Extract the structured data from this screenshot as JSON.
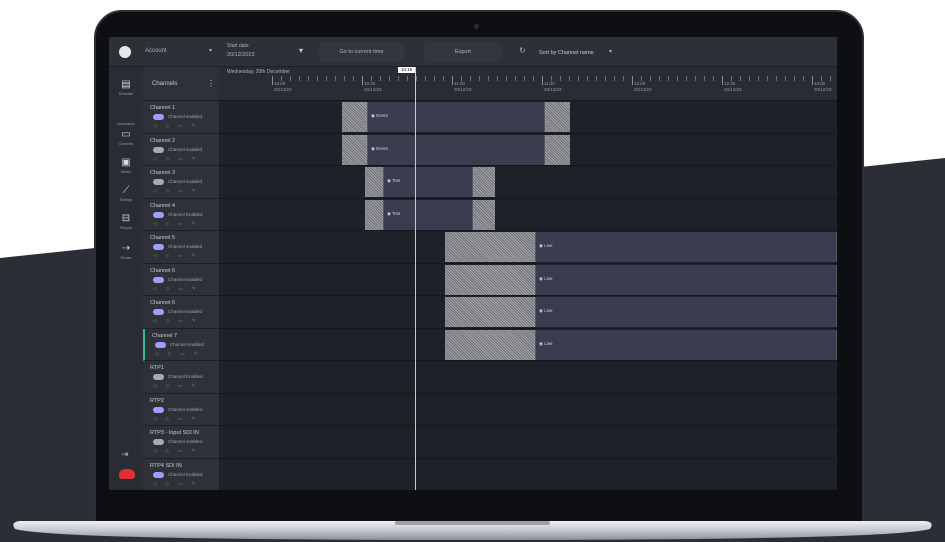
{
  "colors": {
    "accent": "#9aa0ff",
    "active_channel": "#27c08a",
    "brand": "#e03030",
    "background_slate": "#2b2e35"
  },
  "topbar": {
    "account": "Account",
    "date_label": "Start date",
    "date_value": "20/12/2023",
    "center_button": "Go to current time",
    "export_button": "Export",
    "sort_label": "Sort by Channel name"
  },
  "sidenav": {
    "items": [
      {
        "label": "Schedule",
        "icon": "schedule-icon"
      },
      {
        "label": "Automation",
        "icon": "automation-icon"
      },
      {
        "label": "Channels",
        "icon": "channels-icon"
      },
      {
        "label": "Media",
        "icon": "media-icon"
      },
      {
        "label": "Settings",
        "icon": "settings-icon"
      },
      {
        "label": "Playout",
        "icon": "playout-icon"
      },
      {
        "label": "Routes",
        "icon": "routes-icon"
      }
    ],
    "logout_icon": "logout-icon",
    "brand_icon": "cloud-logo-icon"
  },
  "channels": {
    "header": "Channels",
    "header_menu_icon": "kebab-menu-icon",
    "rows": [
      {
        "name": "Channel 1",
        "status": "Channel enabled",
        "enabled": true
      },
      {
        "name": "Channel 2",
        "status": "Channel enabled",
        "enabled": false
      },
      {
        "name": "Channel 3",
        "status": "Channel enabled",
        "enabled": false
      },
      {
        "name": "Channel 4",
        "status": "Channel Enabled",
        "enabled": true
      },
      {
        "name": "Channel 5",
        "status": "Channel enabled",
        "enabled": true
      },
      {
        "name": "Channel 6",
        "status": "Channel enabled",
        "enabled": true
      },
      {
        "name": "Channel 6",
        "status": "Channel enabled",
        "enabled": true
      },
      {
        "name": "Channel 7",
        "status": "Channel enabled",
        "enabled": true
      },
      {
        "name": "RTP1",
        "status": "Channel Enabled",
        "enabled": false
      },
      {
        "name": "RTP2",
        "status": "Channel enabled",
        "enabled": true
      },
      {
        "name": "RTP3 - Input SDI IN",
        "status": "Channel enabled",
        "enabled": false
      },
      {
        "name": "RTP4 SDI IN",
        "status": "Channel Enabled",
        "enabled": true
      }
    ],
    "row_icons": "◁ ◇ ▭ ✎"
  },
  "timeline": {
    "title": "Wednesday, 20th December",
    "now_badge": "10:15",
    "tick_labels": [
      {
        "t": "10:00",
        "d": "20/12/23"
      },
      {
        "t": "10:30",
        "d": "20/12/23"
      },
      {
        "t": "11:00",
        "d": "20/12/23"
      },
      {
        "t": "11:30",
        "d": "20/12/23"
      },
      {
        "t": "12:00",
        "d": "20/12/23"
      },
      {
        "t": "12:30",
        "d": "20/12/23"
      },
      {
        "t": "13:00",
        "d": "20/12/23"
      }
    ],
    "events": [
      {
        "row": 0,
        "label": "Event"
      },
      {
        "row": 1,
        "label": "Event"
      },
      {
        "row": 2,
        "label": "Test"
      },
      {
        "row": 3,
        "label": "Test"
      },
      {
        "row": 4,
        "label": "Live"
      },
      {
        "row": 5,
        "label": "Live"
      },
      {
        "row": 6,
        "label": "Live"
      },
      {
        "row": 7,
        "label": "Live"
      }
    ]
  }
}
